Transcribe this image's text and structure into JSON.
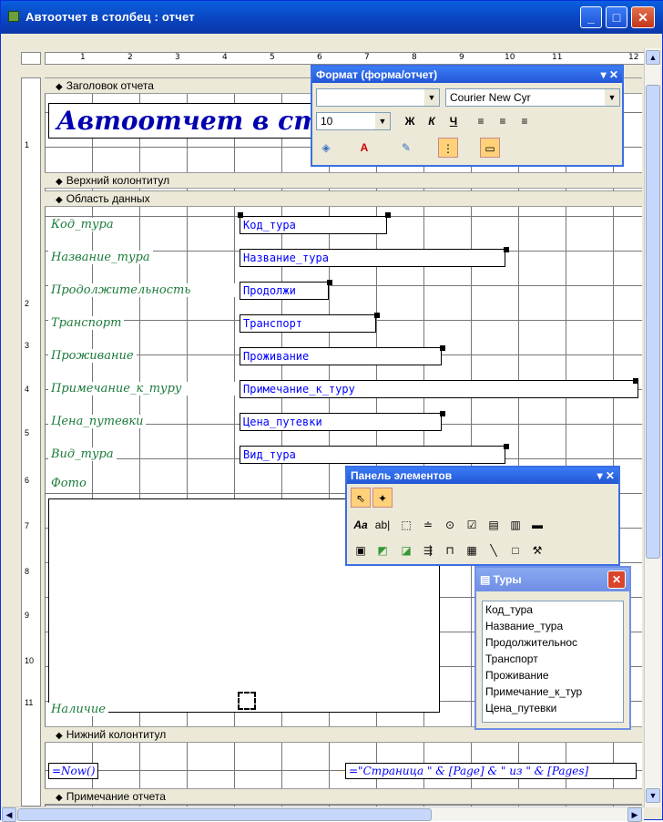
{
  "window": {
    "title": "Автоотчет в столбец : отчет",
    "min": "_",
    "max": "□",
    "close": "✕"
  },
  "ruler": {
    "h": [
      "1",
      "2",
      "3",
      "4",
      "5",
      "6",
      "7",
      "8",
      "9",
      "10",
      "11",
      "12"
    ],
    "v": [
      "1",
      "2",
      "3",
      "4",
      "5",
      "6",
      "7",
      "8",
      "9",
      "10",
      "11"
    ]
  },
  "sections": {
    "report_header": "Заголовок отчета",
    "page_header": "Верхний колонтитул",
    "detail": "Область данных",
    "page_footer": "Нижний колонтитул",
    "report_footer": "Примечание отчета"
  },
  "report_title": "Автоотчет в ст",
  "labels": [
    "Код_тура",
    "Название_тура",
    "Продолжительность",
    "Транспорт",
    "Проживание",
    "Примечание_к_туру",
    "Цена_путевки",
    "Вид_тура",
    "Фото",
    "Наличие"
  ],
  "fields": [
    "Код_тура",
    "Название_тура",
    "Продолжи",
    "Транспорт",
    "Проживание",
    "Примечание_к_туру",
    "Цена_путевки",
    "Вид_тура"
  ],
  "footer": {
    "now": "=Now()",
    "page": "=\"Страница \" & [Page] & \" из \" & [Pages]"
  },
  "format_toolbar": {
    "title": "Формат (форма/отчет)",
    "font": "Courier New Cyr",
    "size": "10",
    "bold": "Ж",
    "italic": "К",
    "underline": "Ч"
  },
  "toolbox": {
    "title": "Панель элементов"
  },
  "field_list": {
    "title": "Туры",
    "items": [
      "Код_тура",
      "Название_тура",
      "Продолжительнос",
      "Транспорт",
      "Проживание",
      "Примечание_к_тур",
      "Цена_путевки"
    ]
  }
}
